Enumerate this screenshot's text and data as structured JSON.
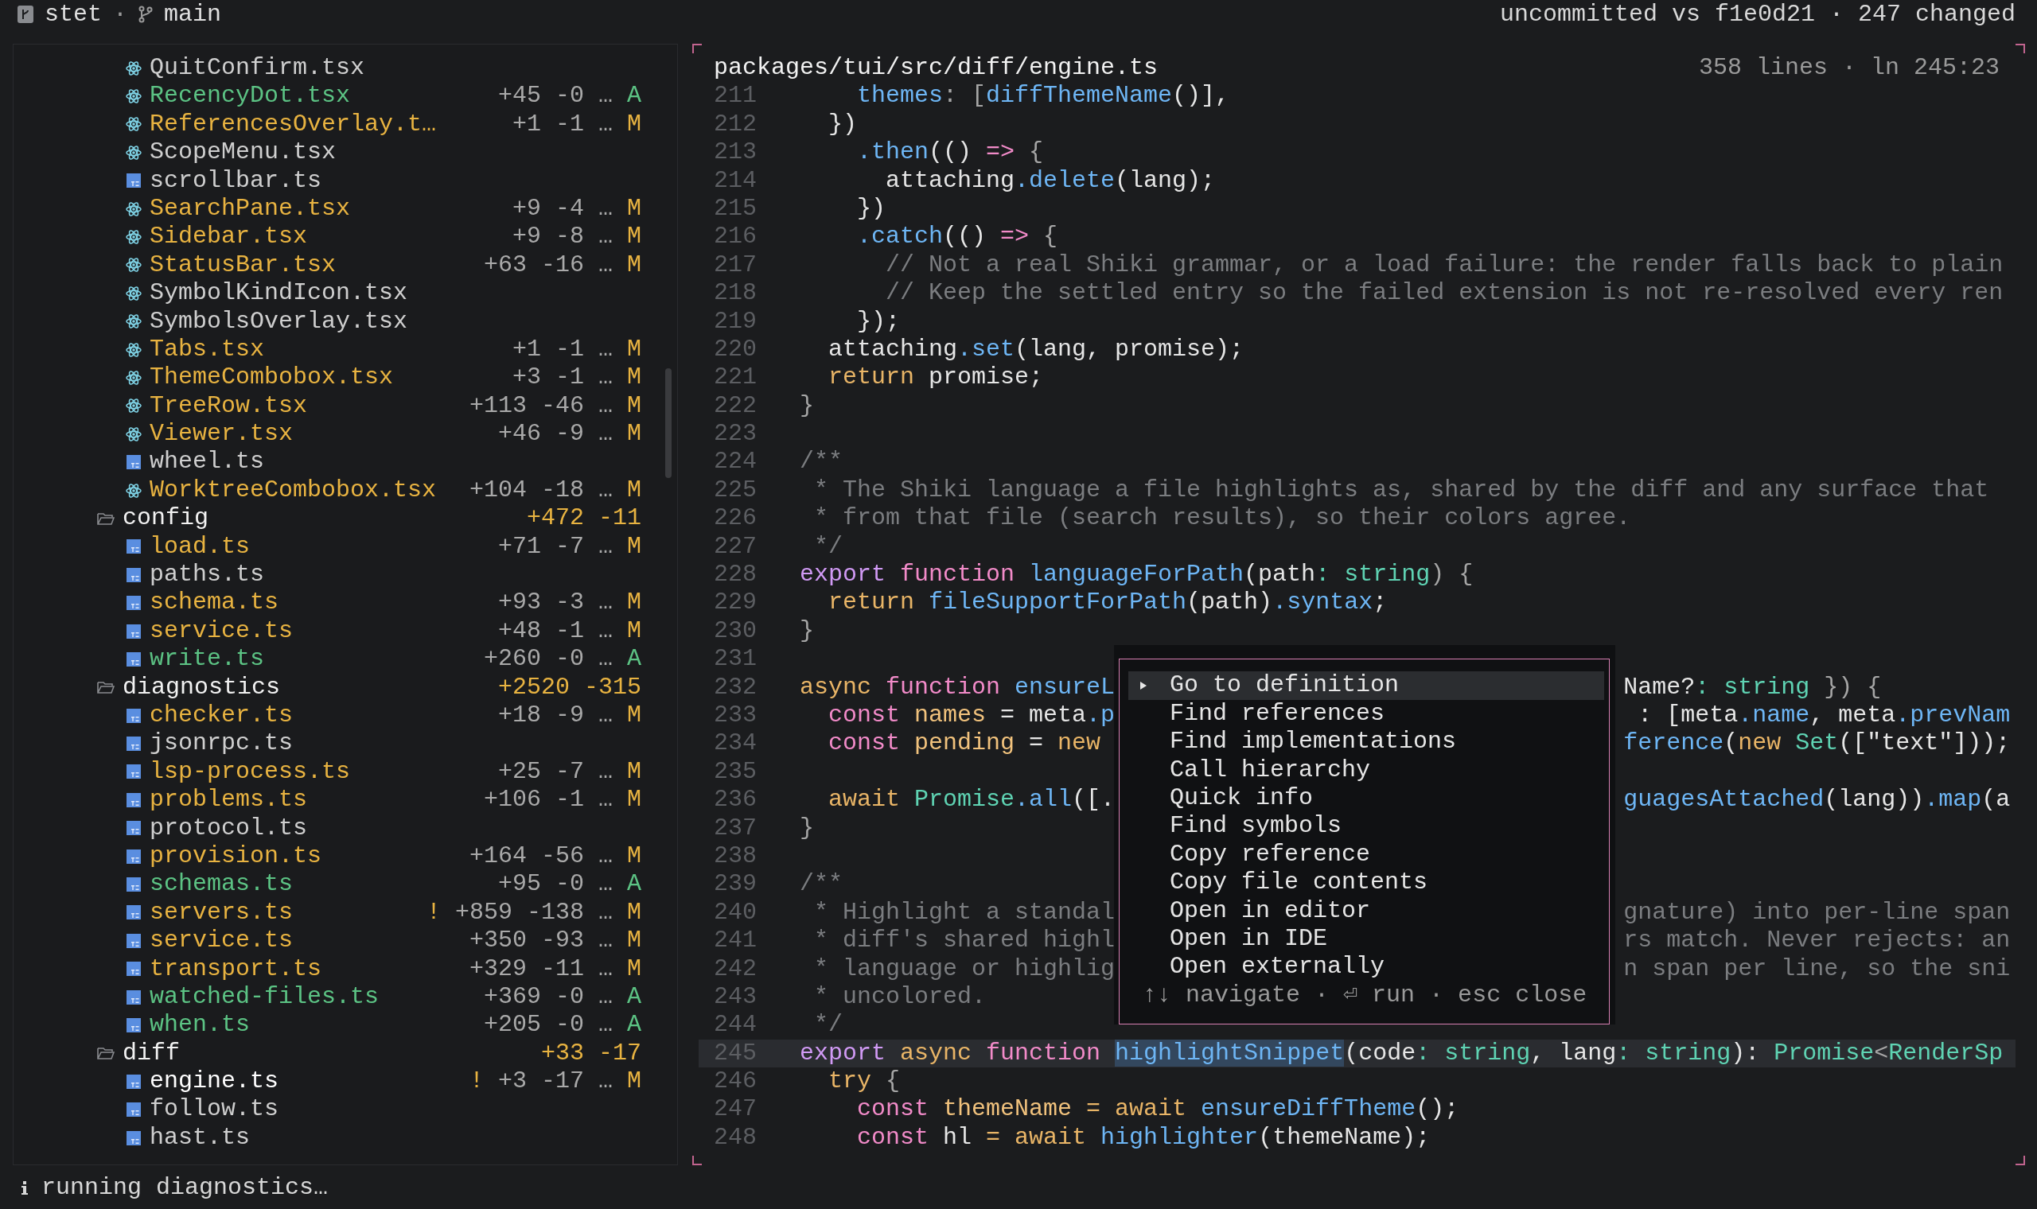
{
  "top_bar": {
    "repo": "stet",
    "separator": "·",
    "branch": "main",
    "summary": "uncommitted vs f1e0d21 · 247 changed"
  },
  "tree": [
    {
      "kind": "group",
      "children": [
        {
          "kind": "tsx-file",
          "name": "QuitConfirm.tsx",
          "selected": false
        },
        {
          "kind": "tsx-file",
          "name": "RecencyDot.tsx",
          "added": "+45",
          "removed": "-0",
          "more": "…",
          "status": "A",
          "selected": false
        },
        {
          "kind": "tsx-file",
          "name": "ReferencesOverlay.t…",
          "added": "+1",
          "removed": "-1",
          "more": "…",
          "status": "M",
          "selected": false
        },
        {
          "kind": "tsx-file",
          "name": "ScopeMenu.tsx",
          "selected": false
        },
        {
          "kind": "ts-file",
          "name": "scrollbar.ts",
          "selected": false
        },
        {
          "kind": "tsx-file",
          "name": "SearchPane.tsx",
          "added": "+9",
          "removed": "-4",
          "more": "…",
          "status": "M",
          "selected": false
        },
        {
          "kind": "tsx-file",
          "name": "Sidebar.tsx",
          "added": "+9",
          "removed": "-8",
          "more": "…",
          "status": "M",
          "selected": false
        },
        {
          "kind": "tsx-file",
          "name": "StatusBar.tsx",
          "added": "+63",
          "removed": "-16",
          "more": "…",
          "status": "M",
          "selected": false
        },
        {
          "kind": "tsx-file",
          "name": "SymbolKindIcon.tsx",
          "selected": false
        },
        {
          "kind": "tsx-file",
          "name": "SymbolsOverlay.tsx",
          "selected": false
        },
        {
          "kind": "tsx-file",
          "name": "Tabs.tsx",
          "added": "+1",
          "removed": "-1",
          "more": "…",
          "status": "M",
          "selected": false
        },
        {
          "kind": "tsx-file",
          "name": "ThemeCombobox.tsx",
          "added": "+3",
          "removed": "-1",
          "more": "…",
          "status": "M",
          "selected": false
        },
        {
          "kind": "tsx-file",
          "name": "TreeRow.tsx",
          "added": "+113",
          "removed": "-46",
          "more": "…",
          "status": "M",
          "selected": false
        },
        {
          "kind": "tsx-file",
          "name": "Viewer.tsx",
          "added": "+46",
          "removed": "-9",
          "more": "…",
          "status": "M",
          "selected": false
        },
        {
          "kind": "ts-file",
          "name": "wheel.ts",
          "selected": false
        },
        {
          "kind": "tsx-file",
          "name": "WorktreeCombobox.tsx",
          "added": "+104",
          "removed": "-18",
          "more": "…",
          "status": "M",
          "selected": false
        }
      ]
    },
    {
      "kind": "folder",
      "name": "config",
      "added": "+472",
      "removed": "-11",
      "expanded": true,
      "children": [
        {
          "kind": "ts-file",
          "name": "load.ts",
          "added": "+71",
          "removed": "-7",
          "more": "…",
          "status": "M",
          "selected": false
        },
        {
          "kind": "ts-file",
          "name": "paths.ts",
          "selected": false
        },
        {
          "kind": "ts-file",
          "name": "schema.ts",
          "added": "+93",
          "removed": "-3",
          "more": "…",
          "status": "M",
          "selected": false
        },
        {
          "kind": "ts-file",
          "name": "service.ts",
          "added": "+48",
          "removed": "-1",
          "more": "…",
          "status": "M",
          "selected": false
        },
        {
          "kind": "ts-file",
          "name": "write.ts",
          "added": "+260",
          "removed": "-0",
          "more": "…",
          "status": "A",
          "selected": false
        }
      ]
    },
    {
      "kind": "folder",
      "name": "diagnostics",
      "added": "+2520",
      "removed": "-315",
      "expanded": true,
      "children": [
        {
          "kind": "ts-file",
          "name": "checker.ts",
          "added": "+18",
          "removed": "-9",
          "more": "…",
          "status": "M",
          "selected": false
        },
        {
          "kind": "ts-file",
          "name": "jsonrpc.ts",
          "selected": false
        },
        {
          "kind": "ts-file",
          "name": "lsp-process.ts",
          "added": "+25",
          "removed": "-7",
          "more": "…",
          "status": "M",
          "selected": false
        },
        {
          "kind": "ts-file",
          "name": "problems.ts",
          "added": "+106",
          "removed": "-1",
          "more": "…",
          "status": "M",
          "selected": false
        },
        {
          "kind": "ts-file",
          "name": "protocol.ts",
          "selected": false
        },
        {
          "kind": "ts-file",
          "name": "provision.ts",
          "added": "+164",
          "removed": "-56",
          "more": "…",
          "status": "M",
          "selected": false
        },
        {
          "kind": "ts-file",
          "name": "schemas.ts",
          "added": "+95",
          "removed": "-0",
          "more": "…",
          "status": "A",
          "selected": false
        },
        {
          "kind": "ts-file",
          "name": "servers.ts",
          "warning": "!",
          "added": "+859",
          "removed": "-138",
          "more": "…",
          "status": "M",
          "selected": false
        },
        {
          "kind": "ts-file",
          "name": "service.ts",
          "added": "+350",
          "removed": "-93",
          "more": "…",
          "status": "M",
          "selected": false
        },
        {
          "kind": "ts-file",
          "name": "transport.ts",
          "added": "+329",
          "removed": "-11",
          "more": "…",
          "status": "M",
          "selected": false
        },
        {
          "kind": "ts-file",
          "name": "watched-files.ts",
          "added": "+369",
          "removed": "-0",
          "more": "…",
          "status": "A",
          "selected": false
        },
        {
          "kind": "ts-file",
          "name": "when.ts",
          "added": "+205",
          "removed": "-0",
          "more": "…",
          "status": "A",
          "selected": false
        }
      ]
    },
    {
      "kind": "folder",
      "name": "diff",
      "added": "+33",
      "removed": "-17",
      "expanded": true,
      "children": [
        {
          "kind": "ts-file",
          "name": "engine.ts",
          "warning": "!",
          "added": "+3",
          "removed": "-17",
          "more": "…",
          "status": "M",
          "selected": true
        },
        {
          "kind": "ts-file",
          "name": "follow.ts",
          "selected": false
        },
        {
          "kind": "ts-file",
          "name": "hast.ts",
          "selected": false
        }
      ]
    }
  ],
  "editor": {
    "path": "packages/tui/src/diff/engine.ts",
    "info": "358 lines · ln 245:23",
    "lines": [
      {
        "number": "211",
        "current": false,
        "tokens": [
          {
            "kind": "function",
            "text": "    themes"
          },
          {
            "kind": "punct",
            "text": ": ["
          },
          {
            "kind": "function",
            "text": "diffThemeName"
          },
          {
            "kind": "plain",
            "text": "()],"
          }
        ]
      },
      {
        "number": "212",
        "current": false,
        "tokens": [
          {
            "kind": "plain",
            "text": "  })"
          }
        ]
      },
      {
        "number": "213",
        "current": false,
        "tokens": [
          {
            "kind": "function",
            "text": "    .then"
          },
          {
            "kind": "plain",
            "text": "(() "
          },
          {
            "kind": "keyword",
            "text": "=>"
          },
          {
            "kind": "punct",
            "text": " {"
          }
        ]
      },
      {
        "number": "214",
        "current": false,
        "tokens": [
          {
            "kind": "plain",
            "text": "      attaching"
          },
          {
            "kind": "function",
            "text": ".delete"
          },
          {
            "kind": "plain",
            "text": "(lang);"
          }
        ]
      },
      {
        "number": "215",
        "current": false,
        "tokens": [
          {
            "kind": "plain",
            "text": "    })"
          }
        ]
      },
      {
        "number": "216",
        "current": false,
        "tokens": [
          {
            "kind": "function",
            "text": "    .catch"
          },
          {
            "kind": "plain",
            "text": "(() "
          },
          {
            "kind": "keyword",
            "text": "=>"
          },
          {
            "kind": "punct",
            "text": " {"
          }
        ]
      },
      {
        "number": "217",
        "current": false,
        "tokens": [
          {
            "kind": "comment",
            "text": "      // Not a real Shiki grammar, or a load failure: the render falls back to plain"
          }
        ]
      },
      {
        "number": "218",
        "current": false,
        "tokens": [
          {
            "kind": "comment",
            "text": "      // Keep the settled entry so the failed extension is not re-resolved every ren"
          }
        ]
      },
      {
        "number": "219",
        "current": false,
        "tokens": [
          {
            "kind": "plain",
            "text": "    });"
          }
        ]
      },
      {
        "number": "220",
        "current": false,
        "tokens": [
          {
            "kind": "plain",
            "text": "  attaching"
          },
          {
            "kind": "function",
            "text": ".set"
          },
          {
            "kind": "plain",
            "text": "(lang, promise);"
          }
        ]
      },
      {
        "number": "221",
        "current": false,
        "tokens": [
          {
            "kind": "control",
            "text": "  return"
          },
          {
            "kind": "plain",
            "text": " promise;"
          }
        ]
      },
      {
        "number": "222",
        "current": false,
        "tokens": [
          {
            "kind": "punct",
            "text": "}"
          }
        ]
      },
      {
        "number": "223",
        "current": false
      },
      {
        "number": "224",
        "current": false,
        "tokens": [
          {
            "kind": "comment",
            "text": "/**"
          }
        ]
      },
      {
        "number": "225",
        "current": false,
        "tokens": [
          {
            "kind": "comment",
            "text": " * The Shiki language a file highlights as, shared by the diff and any surface that"
          }
        ]
      },
      {
        "number": "226",
        "current": false,
        "tokens": [
          {
            "kind": "comment",
            "text": " * from that file (search results), so their colors agree."
          }
        ]
      },
      {
        "number": "227",
        "current": false,
        "tokens": [
          {
            "kind": "comment",
            "text": " */"
          }
        ]
      },
      {
        "number": "228",
        "current": false,
        "tokens": [
          {
            "kind": "export",
            "text": "export"
          },
          {
            "kind": "keyword",
            "text": " function "
          },
          {
            "kind": "function",
            "text": "languageForPath"
          },
          {
            "kind": "plain",
            "text": "(path"
          },
          {
            "kind": "type",
            "text": ": string"
          },
          {
            "kind": "punct",
            "text": ") {"
          }
        ]
      },
      {
        "number": "229",
        "current": false,
        "tokens": [
          {
            "kind": "control",
            "text": "  return "
          },
          {
            "kind": "function",
            "text": "fileSupportForPath"
          },
          {
            "kind": "plain",
            "text": "(path)"
          },
          {
            "kind": "function",
            "text": ".syntax"
          },
          {
            "kind": "plain",
            "text": ";"
          }
        ]
      },
      {
        "number": "230",
        "current": false,
        "tokens": [
          {
            "kind": "punct",
            "text": "}"
          }
        ]
      },
      {
        "number": "231",
        "current": false
      },
      {
        "number": "232",
        "current": false,
        "tokens": [
          {
            "kind": "control",
            "text": "async"
          },
          {
            "kind": "keyword",
            "text": " function "
          },
          {
            "kind": "function",
            "text": "ensureL"
          }
        ],
        "tokens_right": [
          {
            "kind": "plain",
            "text": "Name?"
          },
          {
            "kind": "type",
            "text": ": string"
          },
          {
            "kind": "punct",
            "text": " }) {"
          }
        ]
      },
      {
        "number": "233",
        "current": false,
        "tokens": [
          {
            "kind": "keyword",
            "text": "  const"
          },
          {
            "kind": "variable",
            "text": " names"
          },
          {
            "kind": "plain",
            "text": " = meta"
          },
          {
            "kind": "function",
            "text": ".p"
          }
        ],
        "tokens_right": [
          {
            "kind": "plain",
            "text": " : [meta"
          },
          {
            "kind": "function",
            "text": ".name"
          },
          {
            "kind": "plain",
            "text": ", meta"
          },
          {
            "kind": "function",
            "text": ".prevNam"
          }
        ]
      },
      {
        "number": "234",
        "current": false,
        "tokens": [
          {
            "kind": "keyword",
            "text": "  const"
          },
          {
            "kind": "variable",
            "text": " pending"
          },
          {
            "kind": "plain",
            "text": " = "
          },
          {
            "kind": "control",
            "text": "new"
          }
        ],
        "tokens_right": [
          {
            "kind": "function",
            "text": "ference"
          },
          {
            "kind": "plain",
            "text": "("
          },
          {
            "kind": "control",
            "text": "new"
          },
          {
            "kind": "type",
            "text": " Set"
          },
          {
            "kind": "plain",
            "text": "([\"text\"]));"
          }
        ]
      },
      {
        "number": "235",
        "current": false
      },
      {
        "number": "236",
        "current": false,
        "tokens": [
          {
            "kind": "control",
            "text": "  await"
          },
          {
            "kind": "type",
            "text": " Promise"
          },
          {
            "kind": "function",
            "text": ".all"
          },
          {
            "kind": "plain",
            "text": "([."
          }
        ],
        "tokens_right": [
          {
            "kind": "function",
            "text": "guagesAttached"
          },
          {
            "kind": "plain",
            "text": "(lang))"
          },
          {
            "kind": "function",
            "text": ".map"
          },
          {
            "kind": "plain",
            "text": "(a"
          }
        ]
      },
      {
        "number": "237",
        "current": false,
        "tokens": [
          {
            "kind": "punct",
            "text": "}"
          }
        ]
      },
      {
        "number": "238",
        "current": false
      },
      {
        "number": "239",
        "current": false,
        "tokens": [
          {
            "kind": "comment",
            "text": "/**"
          }
        ]
      },
      {
        "number": "240",
        "current": false,
        "tokens": [
          {
            "kind": "comment",
            "text": " * Highlight a standal"
          }
        ],
        "tokens_right": [
          {
            "kind": "comment",
            "text": "gnature) into per-line span"
          }
        ]
      },
      {
        "number": "241",
        "current": false,
        "tokens": [
          {
            "kind": "comment",
            "text": " * diff's shared highl"
          }
        ],
        "tokens_right": [
          {
            "kind": "comment",
            "text": "rs match. Never rejects: an"
          }
        ]
      },
      {
        "number": "242",
        "current": false,
        "tokens": [
          {
            "kind": "comment",
            "text": " * language or highlig"
          }
        ],
        "tokens_right": [
          {
            "kind": "comment",
            "text": "n span per line, so the sni"
          }
        ]
      },
      {
        "number": "243",
        "current": false,
        "tokens": [
          {
            "kind": "comment",
            "text": " * uncolored."
          }
        ]
      },
      {
        "number": "244",
        "current": false,
        "tokens": [
          {
            "kind": "comment",
            "text": " */"
          }
        ]
      },
      {
        "number": "245",
        "current": true,
        "tokens": [
          {
            "kind": "export",
            "text": "export"
          },
          {
            "kind": "control",
            "text": " async"
          },
          {
            "kind": "keyword",
            "text": " function "
          },
          {
            "kind": "selection",
            "text": "highlightSnippet"
          },
          {
            "kind": "plain",
            "text": "(code"
          },
          {
            "kind": "type",
            "text": ": string"
          },
          {
            "kind": "plain",
            "text": ", lang"
          },
          {
            "kind": "type",
            "text": ": string"
          },
          {
            "kind": "plain",
            "text": "): "
          },
          {
            "kind": "type",
            "text": "Promise"
          },
          {
            "kind": "punct",
            "text": "<"
          },
          {
            "kind": "type",
            "text": "RenderSp"
          }
        ]
      },
      {
        "number": "246",
        "current": false,
        "tokens": [
          {
            "kind": "control",
            "text": "  try"
          },
          {
            "kind": "punct",
            "text": " {"
          }
        ]
      },
      {
        "number": "247",
        "current": false,
        "tokens": [
          {
            "kind": "keyword",
            "text": "    const"
          },
          {
            "kind": "variable",
            "text": " themeName"
          },
          {
            "kind": "control",
            "text": " = await "
          },
          {
            "kind": "function",
            "text": "ensureDiffTheme"
          },
          {
            "kind": "plain",
            "text": "();"
          }
        ]
      },
      {
        "number": "248",
        "current": false,
        "tokens": [
          {
            "kind": "keyword",
            "text": "    const"
          },
          {
            "kind": "plain",
            "text": " hl"
          },
          {
            "kind": "control",
            "text": " = await "
          },
          {
            "kind": "function",
            "text": "highlighter"
          },
          {
            "kind": "plain",
            "text": "(themeName);"
          }
        ]
      }
    ]
  },
  "context_menu": {
    "items": [
      {
        "label": "Go to definition",
        "selected": true
      },
      {
        "label": "Find references",
        "selected": false
      },
      {
        "label": "Find implementations",
        "selected": false
      },
      {
        "label": "Call hierarchy",
        "selected": false
      },
      {
        "label": "Quick info",
        "selected": false
      },
      {
        "label": "Find symbols",
        "selected": false
      },
      {
        "label": "Copy reference",
        "selected": false
      },
      {
        "label": "Copy file contents",
        "selected": false
      },
      {
        "label": "Open in editor",
        "selected": false
      },
      {
        "label": "Open in IDE",
        "selected": false
      },
      {
        "label": "Open externally",
        "selected": false
      }
    ],
    "hint": "↑↓ navigate · ⏎ run · esc close"
  },
  "status_bar": {
    "message": "running diagnostics…"
  }
}
